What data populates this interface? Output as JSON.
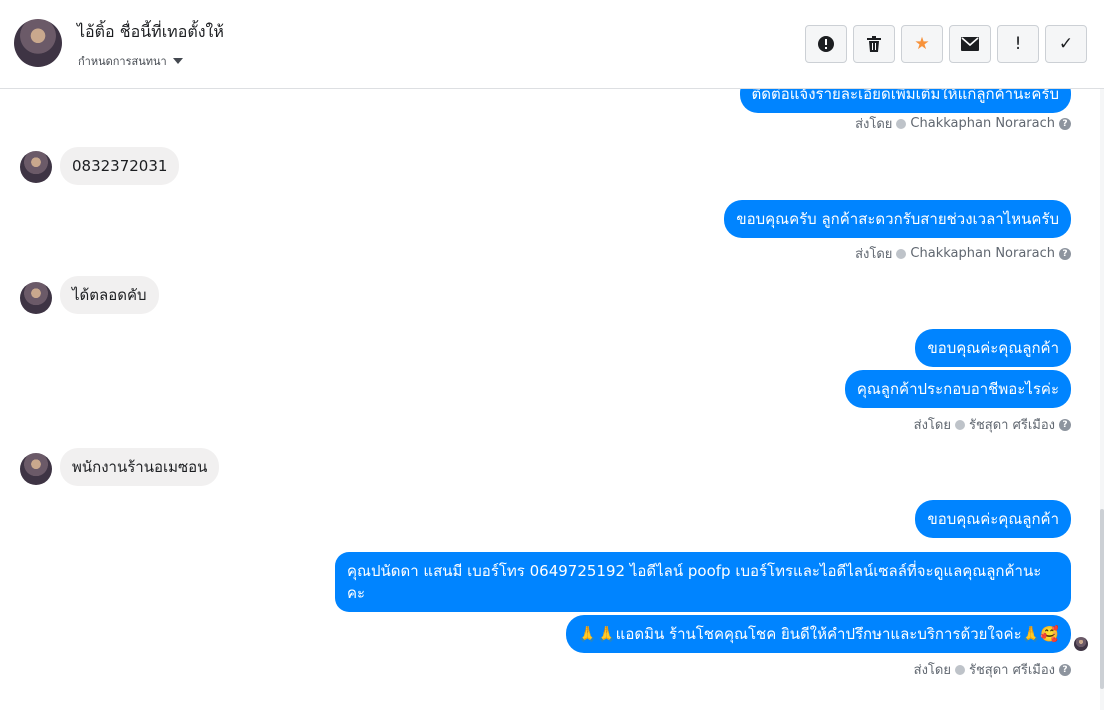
{
  "header": {
    "contact_name": "ไอ้ติ้อ ชื่อนี้ที่เทอตั้งให้",
    "assign_label": "กำหนดการสนทนา",
    "toolbar": [
      {
        "icon": "alert-icon",
        "label": "!"
      },
      {
        "icon": "trash-icon",
        "label": ""
      },
      {
        "icon": "star-icon",
        "label": "★"
      },
      {
        "icon": "mail-icon",
        "label": ""
      },
      {
        "icon": "exclamation-icon",
        "label": "!"
      },
      {
        "icon": "check-icon",
        "label": "✓"
      }
    ]
  },
  "messages": {
    "top_cut": "ติดต่อแจ้งรายละเอียดเพิ่มเติมให้แก่ลูกค้านะครับ",
    "sent_by_1": {
      "prefix": "ส่งโดย",
      "name": "Chakkaphan Norarach"
    },
    "in_1": "0832372031",
    "out_1": "ขอบคุณครับ ลูกค้าสะดวกรับสายช่วงเวลาไหนครับ",
    "sent_by_2": {
      "prefix": "ส่งโดย",
      "name": "Chakkaphan Norarach"
    },
    "in_2": "ได้ตลอดคับ",
    "out_2": "ขอบคุณค่ะคุณลูกค้า",
    "out_3": "คุณลูกค้าประกอบอาชีพอะไรค่ะ",
    "sent_by_3": {
      "prefix": "ส่งโดย",
      "name": "รัชสุดา ศรีเมือง"
    },
    "in_3": "พนักงานร้านอเมซอน",
    "out_4": "ขอบคุณค่ะคุณลูกค้า",
    "out_5": "คุณปนัดดา แสนมี   เบอร์โทร 0649725192  ไอดีไลน์ poofp   เบอร์โทรและไอดีไลน์เซลล์ที่จะดูแลคุณลูกค้านะคะ",
    "out_6": "🙏🙏แอดมิน ร้านโชคคุณโชค ยินดีให้คำปรึกษาและบริการด้วยใจค่ะ🙏🥰",
    "sent_by_4": {
      "prefix": "ส่งโดย",
      "name": "รัชสุดา ศรีเมือง"
    }
  },
  "colors": {
    "outgoing_bubble": "#0084ff",
    "incoming_bubble": "#f1f0f0",
    "star": "#f7923b"
  }
}
